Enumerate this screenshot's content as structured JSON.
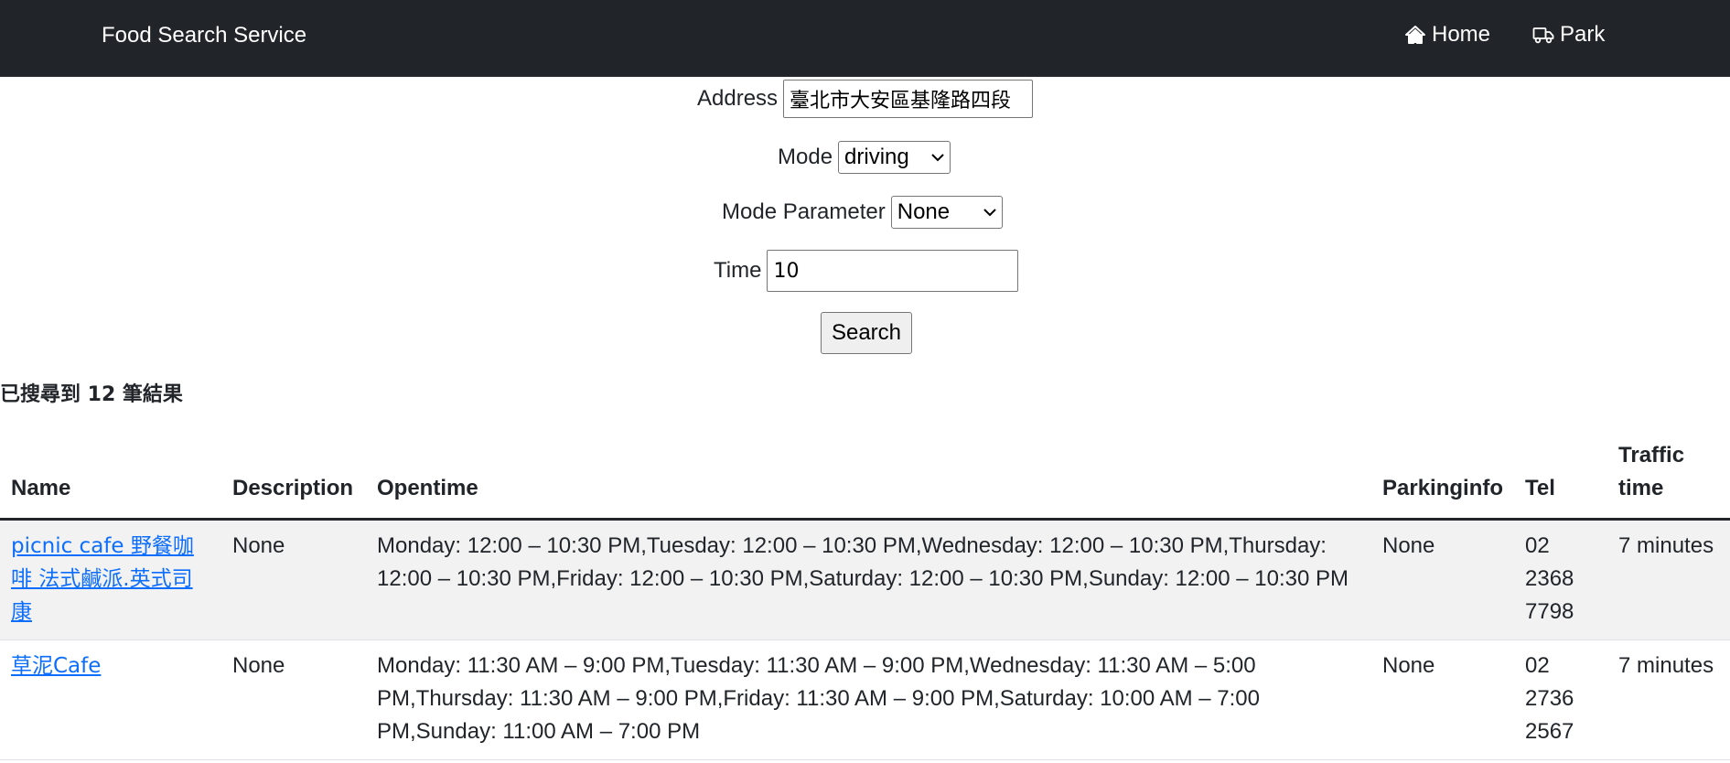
{
  "navbar": {
    "brand": "Food Search Service",
    "links": [
      {
        "label": "Home",
        "icon": "home-icon"
      },
      {
        "label": "Park",
        "icon": "truck-icon"
      }
    ]
  },
  "form": {
    "address": {
      "label": "Address",
      "value": "臺北市大安區基隆路四段"
    },
    "mode": {
      "label": "Mode",
      "selected": "driving"
    },
    "mode_parameter": {
      "label": "Mode Parameter",
      "selected": "None"
    },
    "time": {
      "label": "Time",
      "value": "10"
    },
    "search_label": "Search"
  },
  "result_count": "已搜尋到 12 筆結果",
  "table": {
    "headers": {
      "name": "Name",
      "description": "Description",
      "opentime": "Opentime",
      "parkinginfo": "Parkinginfo",
      "tel": "Tel",
      "traffic_time": "Traffic time"
    },
    "rows": [
      {
        "name": "picnic cafe 野餐咖啡 法式鹹派.英式司康",
        "description": "None",
        "opentime": "Monday: 12:00 – 10:30 PM,Tuesday: 12:00 – 10:30 PM,Wednesday: 12:00 – 10:30 PM,Thursday: 12:00 – 10:30 PM,Friday: 12:00 – 10:30 PM,Saturday: 12:00 – 10:30 PM,Sunday: 12:00 – 10:30 PM",
        "parkinginfo": "None",
        "tel": "02 2368 7798",
        "traffic_time": "7 minutes"
      },
      {
        "name": "草泥Cafe",
        "description": "None",
        "opentime": "Monday: 11:30 AM – 9:00 PM,Tuesday: 11:30 AM – 9:00 PM,Wednesday: 11:30 AM – 5:00 PM,Thursday: 11:30 AM – 9:00 PM,Friday: 11:30 AM – 9:00 PM,Saturday: 10:00 AM – 7:00 PM,Sunday: 11:00 AM – 7:00 PM",
        "parkinginfo": "None",
        "tel": "02 2736 2567",
        "traffic_time": "7 minutes"
      }
    ]
  },
  "colors": {
    "navbar": "#212529",
    "link": "#0d6efd",
    "row_stripe": "#f2f2f2"
  }
}
